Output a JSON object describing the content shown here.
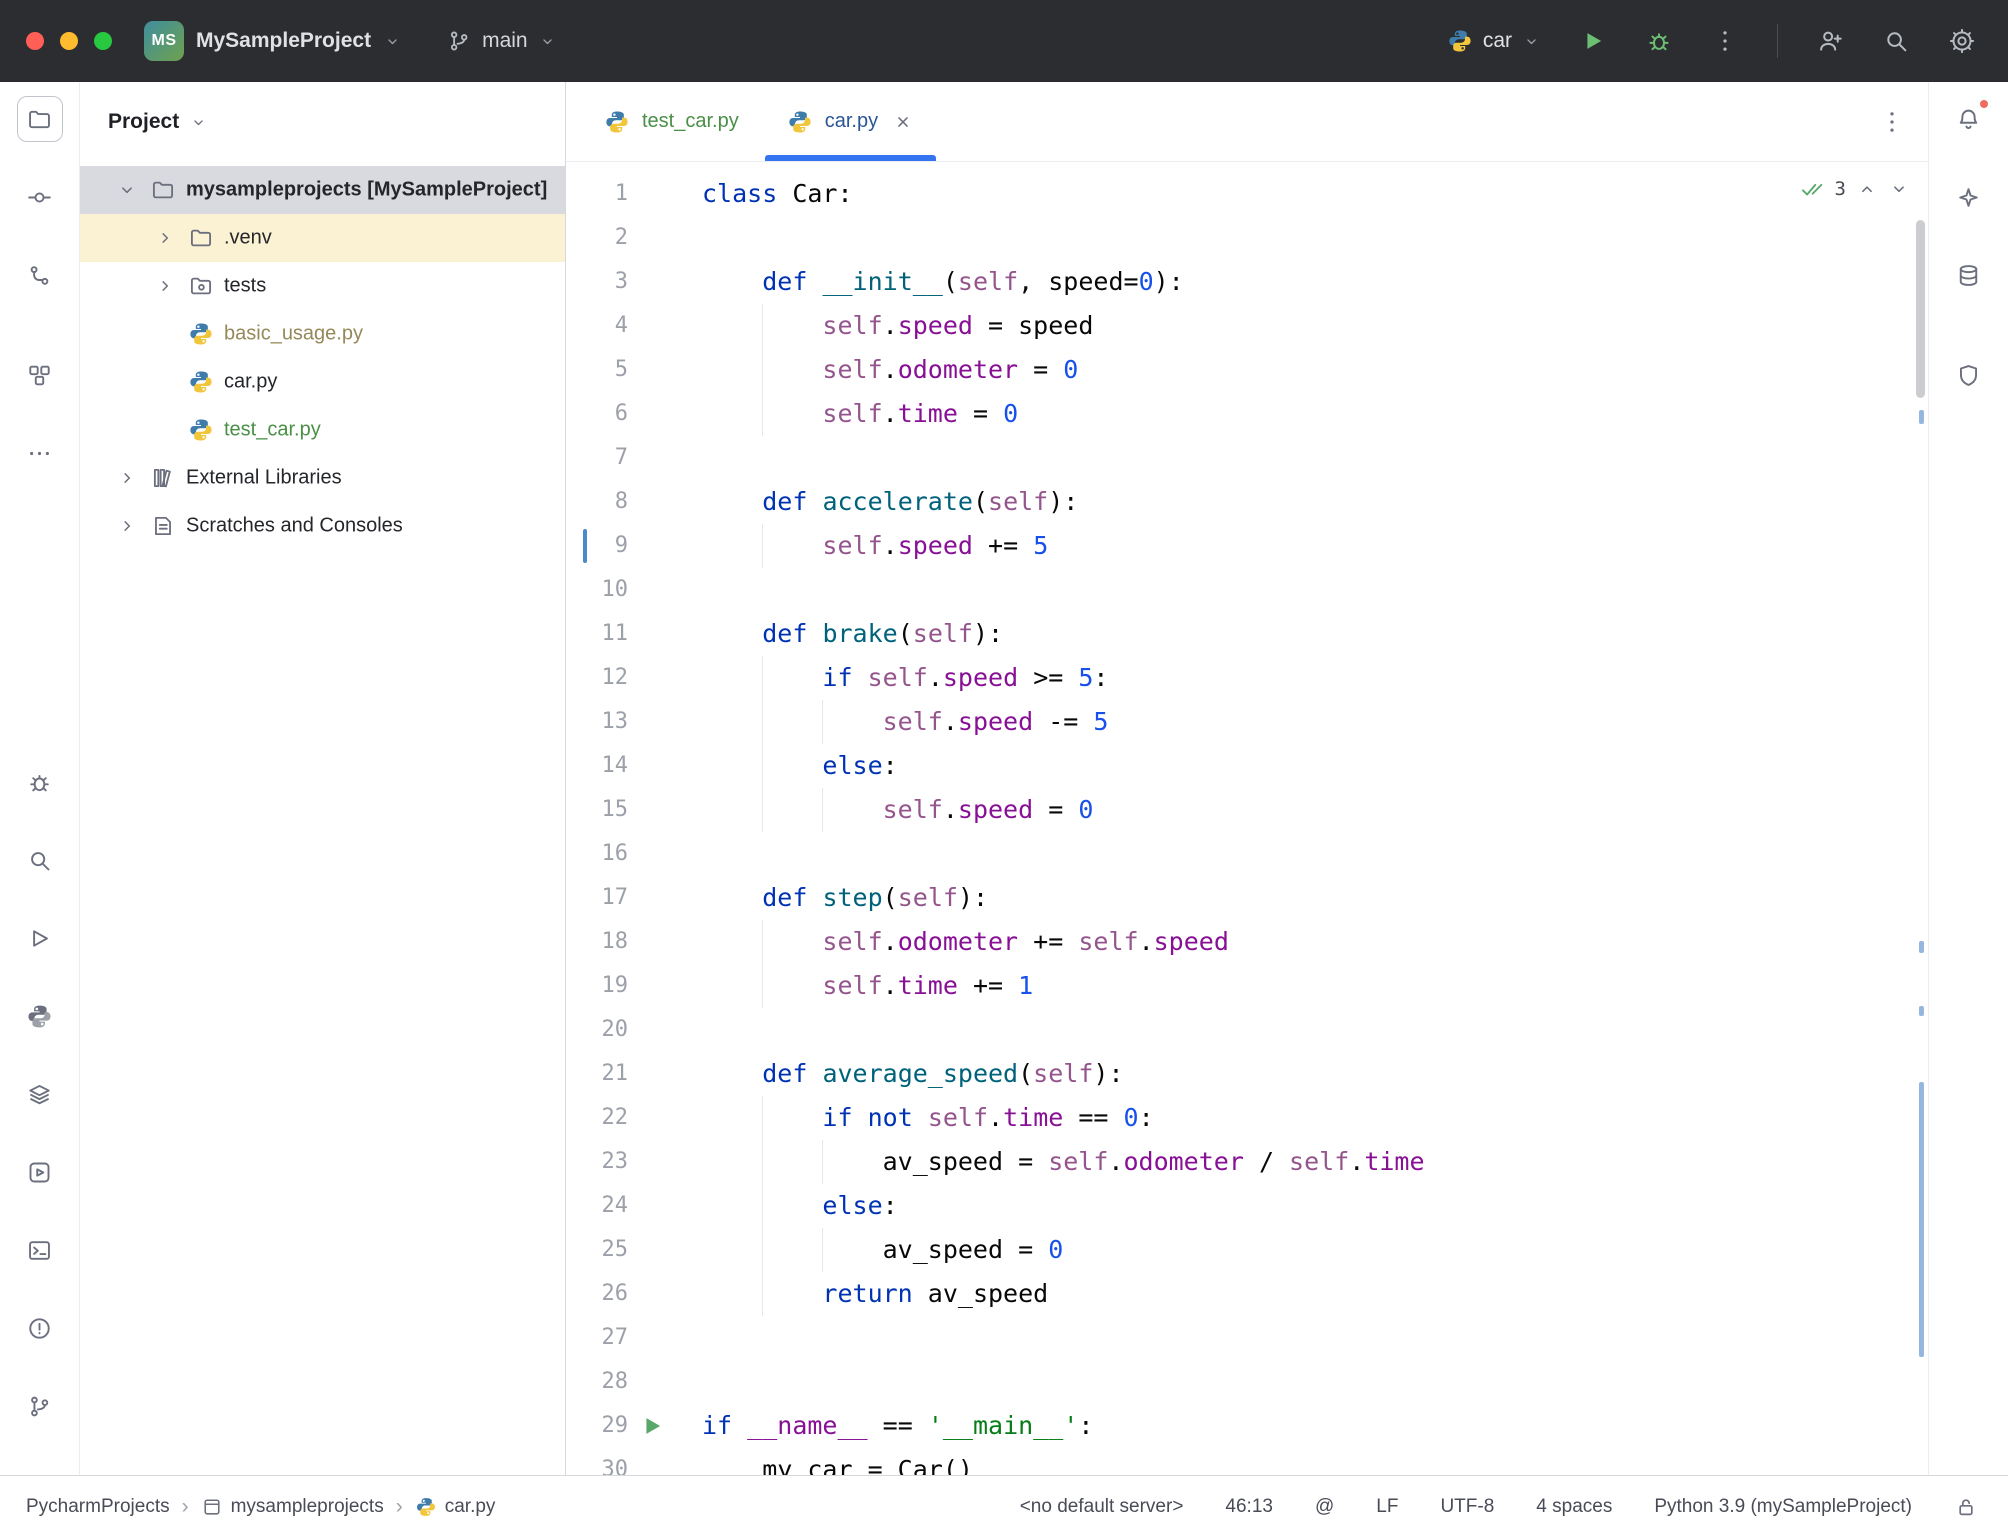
{
  "titlebar": {
    "project_icon_text": "MS",
    "project_name": "MySampleProject",
    "branch_name": "main",
    "run_config_name": "car"
  },
  "left_stripe": {
    "top": [
      {
        "name": "project",
        "icon": "folder-icon",
        "active": true
      },
      {
        "name": "commit",
        "icon": "commit-icon"
      },
      {
        "name": "vcs-graph",
        "icon": "graph-icon"
      },
      {
        "name": "structure",
        "icon": "structure-icon",
        "gap": true
      },
      {
        "name": "more-tool-windows",
        "icon": "more-icon"
      }
    ],
    "bottom": [
      {
        "name": "debug",
        "icon": "debug-icon"
      },
      {
        "name": "find",
        "icon": "search-icon"
      },
      {
        "name": "run",
        "icon": "run-icon"
      },
      {
        "name": "python-packages",
        "icon": "python-mono-icon"
      },
      {
        "name": "python-console",
        "icon": "layers-icon"
      },
      {
        "name": "services",
        "icon": "services-icon"
      },
      {
        "name": "terminal",
        "icon": "terminal-icon"
      },
      {
        "name": "problems",
        "icon": "problems-icon"
      },
      {
        "name": "version-control",
        "icon": "branch-icon"
      }
    ]
  },
  "right_stripe": {
    "items": [
      {
        "name": "notifications",
        "icon": "bell-icon",
        "badge": true
      },
      {
        "name": "ai-assistant",
        "icon": "ai-assistant-icon"
      },
      {
        "name": "database",
        "icon": "database-icon"
      },
      {
        "name": "security",
        "icon": "shield-icon",
        "gap": true
      }
    ]
  },
  "project_panel": {
    "title": "Project",
    "tree": [
      {
        "label": "mysampleprojects [MySampleProject]",
        "icon": "folder-icon",
        "chevron": "down",
        "depth": 0,
        "bold": true,
        "bg": "selected"
      },
      {
        "label": ".venv",
        "icon": "folder-icon",
        "chevron": "right",
        "depth": 1,
        "bg": "cream"
      },
      {
        "label": "tests",
        "icon": "tests-folder-icon",
        "chevron": "right",
        "depth": 1
      },
      {
        "label": "basic_usage.py",
        "icon": "python-icon",
        "depth": 1,
        "color": "#95895A"
      },
      {
        "label": "car.py",
        "icon": "python-icon",
        "depth": 1
      },
      {
        "label": "test_car.py",
        "icon": "python-icon",
        "depth": 1,
        "color": "#4A8F46"
      },
      {
        "label": "External Libraries",
        "icon": "library-icon",
        "chevron": "right",
        "depth": 0
      },
      {
        "label": "Scratches and Consoles",
        "icon": "scratches-icon",
        "chevron": "right",
        "depth": 0
      }
    ]
  },
  "editor": {
    "tabs": [
      {
        "label": "test_car.py",
        "icon": "python-icon",
        "color": "#4A8F46",
        "active": false,
        "closable": false
      },
      {
        "label": "car.py",
        "icon": "python-icon",
        "color": "#2A5699",
        "active": true,
        "closable": true
      }
    ],
    "inspection_count": "3",
    "lines": [
      {
        "segs": [
          [
            "kw",
            "class"
          ],
          [
            "pl",
            " Car:"
          ]
        ]
      },
      {
        "segs": []
      },
      {
        "segs": [
          [
            "pl",
            "    "
          ],
          [
            "kw",
            "def"
          ],
          [
            "pl",
            " "
          ],
          [
            "fn",
            "__init__"
          ],
          [
            "pl",
            "("
          ],
          [
            "self",
            "self"
          ],
          [
            "pl",
            ", speed="
          ],
          [
            "num",
            "0"
          ],
          [
            "pl",
            "):"
          ]
        ]
      },
      {
        "segs": [
          [
            "pl",
            "        "
          ],
          [
            "self",
            "self"
          ],
          [
            "pl",
            "."
          ],
          [
            "attr",
            "speed"
          ],
          [
            "pl",
            " = speed"
          ]
        ],
        "guides": [
          4
        ]
      },
      {
        "segs": [
          [
            "pl",
            "        "
          ],
          [
            "self",
            "self"
          ],
          [
            "pl",
            "."
          ],
          [
            "attr",
            "odometer"
          ],
          [
            "pl",
            " = "
          ],
          [
            "num",
            "0"
          ]
        ],
        "guides": [
          4
        ]
      },
      {
        "segs": [
          [
            "pl",
            "        "
          ],
          [
            "self",
            "self"
          ],
          [
            "pl",
            "."
          ],
          [
            "attr",
            "time"
          ],
          [
            "pl",
            " = "
          ],
          [
            "num",
            "0"
          ]
        ],
        "guides": [
          4
        ]
      },
      {
        "segs": []
      },
      {
        "segs": [
          [
            "pl",
            "    "
          ],
          [
            "kw",
            "def"
          ],
          [
            "pl",
            " "
          ],
          [
            "fn",
            "accelerate"
          ],
          [
            "pl",
            "("
          ],
          [
            "self",
            "self"
          ],
          [
            "pl",
            "):"
          ]
        ]
      },
      {
        "segs": [
          [
            "pl",
            "        "
          ],
          [
            "self",
            "self"
          ],
          [
            "pl",
            "."
          ],
          [
            "attr",
            "speed"
          ],
          [
            "pl",
            " += "
          ],
          [
            "num",
            "5"
          ]
        ],
        "guides": [
          4
        ],
        "gutter": "caret"
      },
      {
        "segs": []
      },
      {
        "segs": [
          [
            "pl",
            "    "
          ],
          [
            "kw",
            "def"
          ],
          [
            "pl",
            " "
          ],
          [
            "fn",
            "brake"
          ],
          [
            "pl",
            "("
          ],
          [
            "self",
            "self"
          ],
          [
            "pl",
            "):"
          ]
        ]
      },
      {
        "segs": [
          [
            "pl",
            "        "
          ],
          [
            "kw",
            "if"
          ],
          [
            "pl",
            " "
          ],
          [
            "self",
            "self"
          ],
          [
            "pl",
            "."
          ],
          [
            "attr",
            "speed"
          ],
          [
            "pl",
            " >= "
          ],
          [
            "num",
            "5"
          ],
          [
            "pl",
            ":"
          ]
        ],
        "guides": [
          4
        ]
      },
      {
        "segs": [
          [
            "pl",
            "            "
          ],
          [
            "self",
            "self"
          ],
          [
            "pl",
            "."
          ],
          [
            "attr",
            "speed"
          ],
          [
            "pl",
            " -= "
          ],
          [
            "num",
            "5"
          ]
        ],
        "guides": [
          4,
          8
        ]
      },
      {
        "segs": [
          [
            "pl",
            "        "
          ],
          [
            "kw",
            "else"
          ],
          [
            "pl",
            ":"
          ]
        ],
        "guides": [
          4
        ]
      },
      {
        "segs": [
          [
            "pl",
            "            "
          ],
          [
            "self",
            "self"
          ],
          [
            "pl",
            "."
          ],
          [
            "attr",
            "speed"
          ],
          [
            "pl",
            " = "
          ],
          [
            "num",
            "0"
          ]
        ],
        "guides": [
          4,
          8
        ]
      },
      {
        "segs": []
      },
      {
        "segs": [
          [
            "pl",
            "    "
          ],
          [
            "kw",
            "def"
          ],
          [
            "pl",
            " "
          ],
          [
            "fn",
            "step"
          ],
          [
            "pl",
            "("
          ],
          [
            "self",
            "self"
          ],
          [
            "pl",
            "):"
          ]
        ]
      },
      {
        "segs": [
          [
            "pl",
            "        "
          ],
          [
            "self",
            "self"
          ],
          [
            "pl",
            "."
          ],
          [
            "attr",
            "odometer"
          ],
          [
            "pl",
            " += "
          ],
          [
            "self",
            "self"
          ],
          [
            "pl",
            "."
          ],
          [
            "attr",
            "speed"
          ]
        ],
        "guides": [
          4
        ]
      },
      {
        "segs": [
          [
            "pl",
            "        "
          ],
          [
            "self",
            "self"
          ],
          [
            "pl",
            "."
          ],
          [
            "attr",
            "time"
          ],
          [
            "pl",
            " += "
          ],
          [
            "num",
            "1"
          ]
        ],
        "guides": [
          4
        ]
      },
      {
        "segs": []
      },
      {
        "segs": [
          [
            "pl",
            "    "
          ],
          [
            "kw",
            "def"
          ],
          [
            "pl",
            " "
          ],
          [
            "fn",
            "average_speed"
          ],
          [
            "pl",
            "("
          ],
          [
            "self",
            "self"
          ],
          [
            "pl",
            "):"
          ]
        ]
      },
      {
        "segs": [
          [
            "pl",
            "        "
          ],
          [
            "kw",
            "if"
          ],
          [
            "pl",
            " "
          ],
          [
            "kw",
            "not"
          ],
          [
            "pl",
            " "
          ],
          [
            "self",
            "self"
          ],
          [
            "pl",
            "."
          ],
          [
            "attr",
            "time"
          ],
          [
            "pl",
            " == "
          ],
          [
            "num",
            "0"
          ],
          [
            "pl",
            ":"
          ]
        ],
        "guides": [
          4
        ]
      },
      {
        "segs": [
          [
            "pl",
            "            av_speed = "
          ],
          [
            "self",
            "self"
          ],
          [
            "pl",
            "."
          ],
          [
            "attr",
            "odometer"
          ],
          [
            "pl",
            " / "
          ],
          [
            "self",
            "self"
          ],
          [
            "pl",
            "."
          ],
          [
            "attr",
            "time"
          ]
        ],
        "guides": [
          4,
          8
        ]
      },
      {
        "segs": [
          [
            "pl",
            "        "
          ],
          [
            "kw",
            "else"
          ],
          [
            "pl",
            ":"
          ]
        ],
        "guides": [
          4
        ]
      },
      {
        "segs": [
          [
            "pl",
            "            av_speed = "
          ],
          [
            "num",
            "0"
          ]
        ],
        "guides": [
          4,
          8
        ]
      },
      {
        "segs": [
          [
            "pl",
            "        "
          ],
          [
            "kw",
            "return"
          ],
          [
            "pl",
            " av_speed"
          ]
        ],
        "guides": [
          4
        ]
      },
      {
        "segs": []
      },
      {
        "segs": []
      },
      {
        "segs": [
          [
            "kw",
            "if"
          ],
          [
            "pl",
            " "
          ],
          [
            "attr",
            "__name__"
          ],
          [
            "pl",
            " == "
          ],
          [
            "str",
            "'__main__'"
          ],
          [
            "pl",
            ":"
          ]
        ],
        "gutter": "run"
      },
      {
        "segs": [
          [
            "pl",
            "    my_car = Car()"
          ]
        ],
        "gutter": "dot"
      }
    ]
  },
  "statusbar": {
    "breadcrumbs": [
      {
        "label": "PycharmProjects"
      },
      {
        "label": "mysampleprojects",
        "icon": "module-icon"
      },
      {
        "label": "car.py",
        "icon": "python-icon"
      }
    ],
    "items": [
      "<no default server>",
      "46:13",
      "@",
      "LF",
      "UTF-8",
      "4 spaces",
      "Python 3.9 (mySampleProject)"
    ]
  },
  "colors": {
    "accent": "#3574F0",
    "vcs_added": "#4A8F46",
    "vcs_modified": "#2A5699",
    "run_green": "#59A869"
  }
}
